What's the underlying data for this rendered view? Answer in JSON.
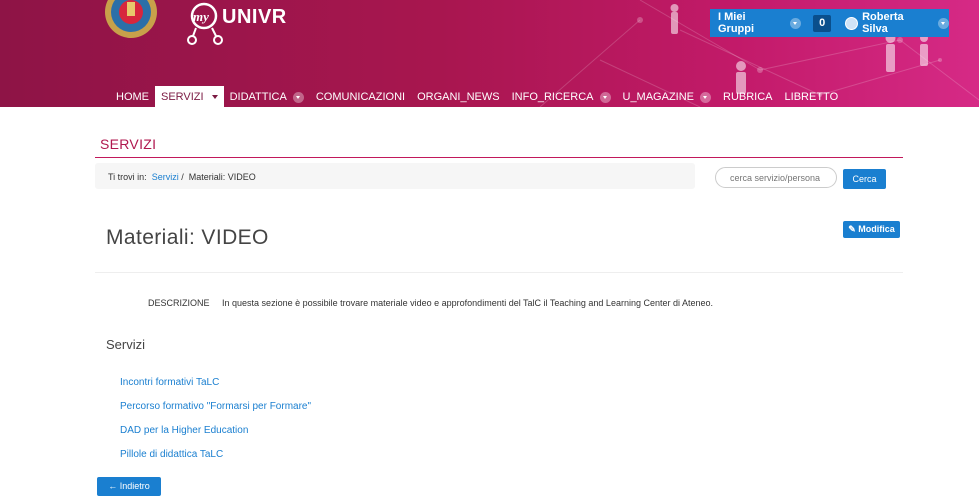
{
  "header": {
    "logo_text": "UNIVR",
    "logo_prefix": "my",
    "groups_label": "I Miei Gruppi",
    "notifications_count": "0",
    "user_name": "Roberta Silva",
    "colors": {
      "header_start": "#8e1446",
      "header_end": "#d62a86",
      "accent_blue": "#1a7fd0"
    }
  },
  "nav": {
    "items": [
      {
        "label": "HOME"
      },
      {
        "label": "SERVIZI"
      },
      {
        "label": "DIDATTICA"
      },
      {
        "label": "COMUNICAZIONI"
      },
      {
        "label": "ORGANI_NEWS"
      },
      {
        "label": "INFO_RICERCA"
      },
      {
        "label": "U_MAGAZINE"
      },
      {
        "label": "RUBRICA"
      },
      {
        "label": "LIBRETTO"
      }
    ]
  },
  "section": {
    "title": "SERVIZI",
    "breadcrumb_prefix": "Ti trovi in:",
    "breadcrumb_link": "Servizi",
    "breadcrumb_sep": "/",
    "breadcrumb_current": "Materiali: VIDEO",
    "search_placeholder": "cerca servizio/persona",
    "search_button": "Cerca",
    "edit_button": "Modifica"
  },
  "page": {
    "title": "Materiali: VIDEO",
    "description_label": "DESCRIZIONE",
    "description_text": "In questa sezione è possibile trovare materiale video e approfondimenti del TalC il Teaching and Learning Center di Ateneo.",
    "services_heading": "Servizi",
    "service_links": [
      "Incontri formativi TaLC",
      "Percorso formativo \"Formarsi per Formare\"",
      "DAD per la Higher Education",
      "Pillole di didattica TaLC"
    ],
    "back_button": "Indietro"
  }
}
